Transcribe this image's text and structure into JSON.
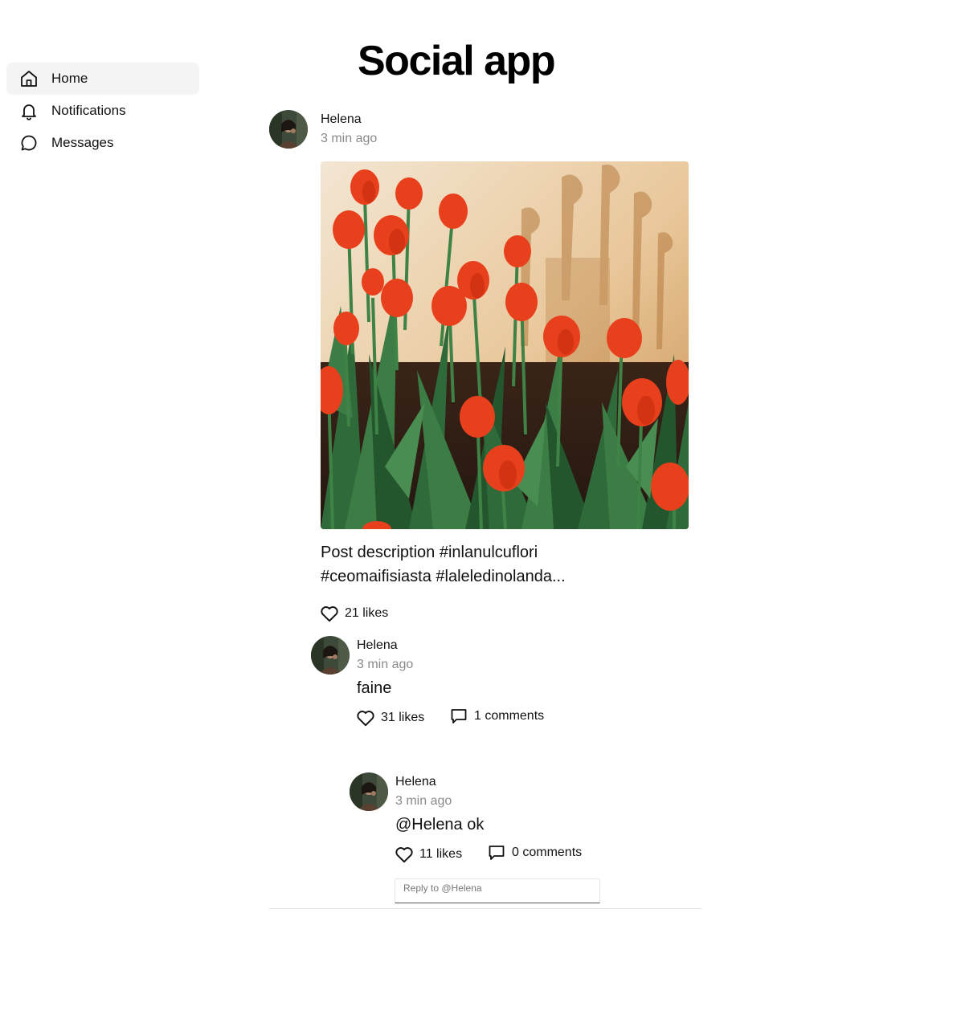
{
  "app": {
    "title": "Social app"
  },
  "sidebar": {
    "items": [
      {
        "label": "Home",
        "icon": "home-icon",
        "active": true
      },
      {
        "label": "Notifications",
        "icon": "bell-icon",
        "active": false
      },
      {
        "label": "Messages",
        "icon": "message-icon",
        "active": false
      }
    ]
  },
  "post": {
    "author": "Helena",
    "time": "3 min ago",
    "description_line1": "Post description #inlanulcuflori",
    "description_line2": "#ceomaifisiasta #laleledinolanda...",
    "likes": "21 likes",
    "image": "red tulips photo"
  },
  "comment": {
    "author": "Helena",
    "time": "3 min ago",
    "text": "faine",
    "likes": "31 likes",
    "comments": "1 comments"
  },
  "reply": {
    "author": "Helena",
    "time": "3 min ago",
    "text": "@Helena ok",
    "likes": "11 likes",
    "comments": "0 comments",
    "input_placeholder": "Reply to @Helena"
  },
  "colors": {
    "tulip": "#e8401c",
    "leaf": "#2f6b3a",
    "muted_text": "#8a8a8a"
  }
}
